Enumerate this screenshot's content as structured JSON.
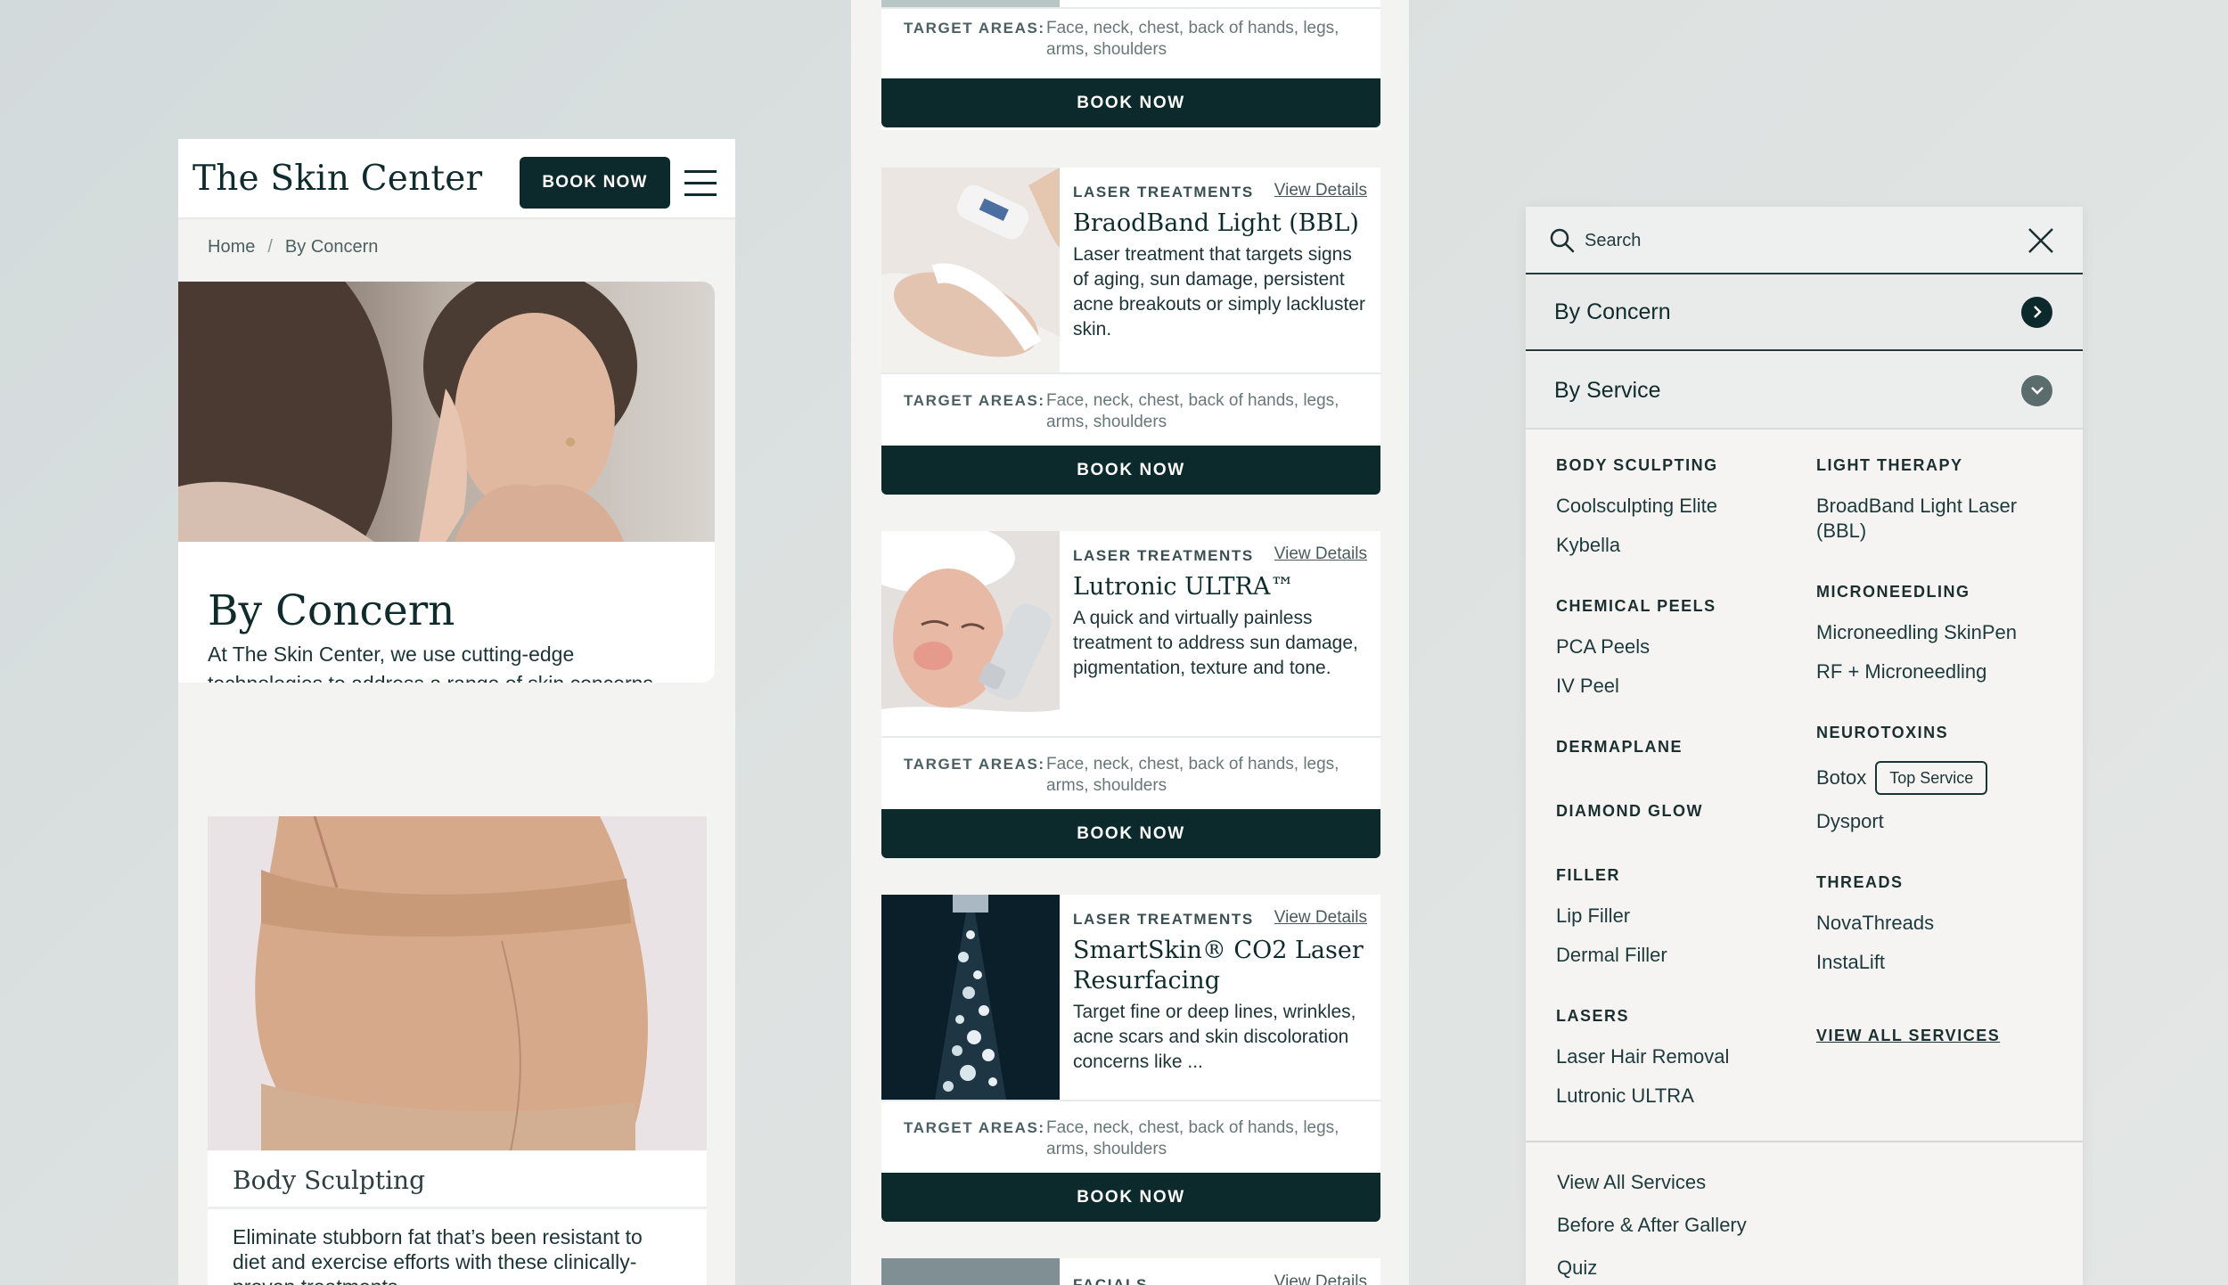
{
  "phone1": {
    "logo": "The Skin Center",
    "book_label": "BOOK NOW",
    "breadcrumb": {
      "home": "Home",
      "separator": "/",
      "current": "By Concern"
    },
    "hero": {
      "title": "By Concern",
      "description": "At The Skin Center, we use cutting-edge technologies to address a range of skin concerns with tailored, effective treatments."
    },
    "card": {
      "title": "Body Sculpting",
      "description": "Eliminate stubborn fat that’s been resistant to diet and exercise efforts with these clinically-proven treatments."
    }
  },
  "phone2": {
    "view_details": "View Details",
    "target_label": "TARGET AREAS:",
    "book_label": "BOOK NOW",
    "top_card": {
      "target_text": "Face, neck, chest, back of hands, legs, arms, shoulders"
    },
    "services": [
      {
        "category": "LASER TREATMENTS",
        "title": "BraodBand Light (BBL)",
        "description": "Laser treatment that targets signs of aging, sun damage, persistent acne breakouts or simply lackluster skin.",
        "target_text": "Face, neck, chest, back of hands, legs, arms, shoulders"
      },
      {
        "category": "LASER TREATMENTS",
        "title": "Lutronic ULTRA™",
        "description": "A quick and virtually painless treatment to address sun damage, pigmentation, texture and tone.",
        "target_text": "Face, neck, chest, back of hands, legs, arms, shoulders"
      },
      {
        "category": "LASER TREATMENTS",
        "title": "SmartSkin® CO2 Laser Resurfacing",
        "description": "Target fine or deep lines, wrinkles, acne scars and skin discoloration concerns like ...",
        "target_text": "Face, neck, chest, back of hands, legs, arms, shoulders"
      }
    ],
    "partial_bottom": {
      "category": "FACIALS",
      "link": "View Details"
    }
  },
  "phone3": {
    "search_placeholder": "Search",
    "rows": {
      "concern": "By Concern",
      "service": "By Service"
    },
    "left_col": [
      {
        "heading": "BODY SCULPTING",
        "items": [
          "Coolsculpting Elite",
          "Kybella"
        ]
      },
      {
        "heading": "CHEMICAL PEELS",
        "items": [
          "PCA Peels",
          "IV Peel"
        ]
      },
      {
        "heading": "DERMAPLANE",
        "items": []
      },
      {
        "heading": "DIAMOND GLOW",
        "items": []
      },
      {
        "heading": "FILLER",
        "items": [
          "Lip Filler",
          "Dermal Filler"
        ]
      },
      {
        "heading": "LASERS",
        "items": [
          "Laser Hair Removal",
          "Lutronic ULTRA"
        ]
      }
    ],
    "right_col": {
      "light_therapy": {
        "heading": "LIGHT THERAPY",
        "items": [
          "BroadBand Light Laser (BBL)"
        ]
      },
      "microneedling": {
        "heading": "MICRONEEDLING",
        "items": [
          "Microneedling SkinPen",
          "RF + Microneedling"
        ]
      },
      "neurotoxins": {
        "heading": "NEUROTOXINS",
        "items": [
          "Botox",
          "Dysport"
        ],
        "badge": "Top Service"
      },
      "threads": {
        "heading": "THREADS",
        "items": [
          "NovaThreads",
          "InstaLift"
        ]
      },
      "view_all": "VIEW ALL SERVICES"
    },
    "footer_links": [
      "View All Services",
      "Before & After Gallery",
      "Quiz"
    ]
  },
  "colors": {
    "brand_dark": "#0c2a2b",
    "background": "#dde2e1",
    "card": "#ffffff"
  }
}
